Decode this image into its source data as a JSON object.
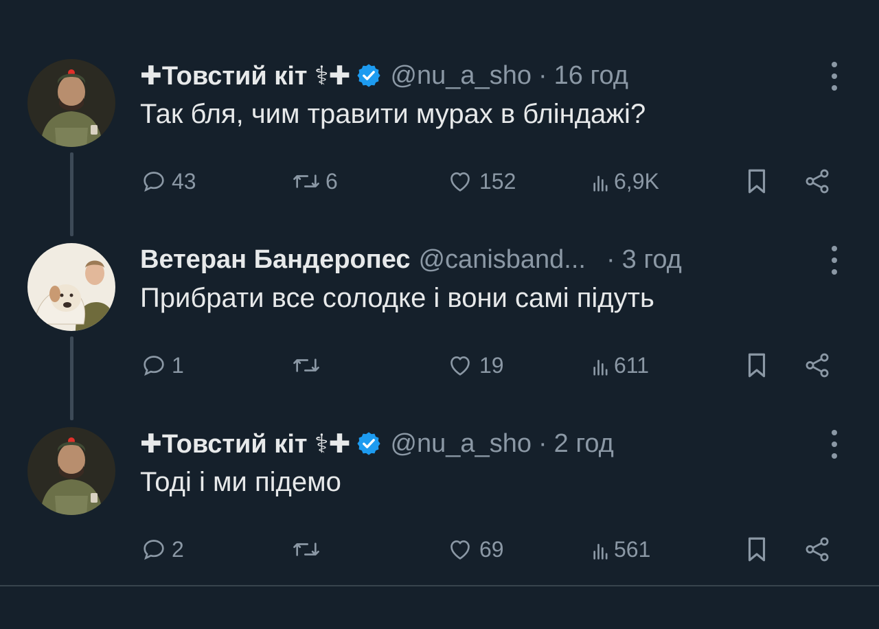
{
  "colors": {
    "background": "#15202b",
    "text_primary": "#e7e9ea",
    "text_secondary": "#8b98a5",
    "verified": "#1d9bf0",
    "divider": "#38444d"
  },
  "tweets": [
    {
      "name": "✚Товстий кіт ⚕✚",
      "verified": true,
      "handle": "@nu_a_sho",
      "separator": "·",
      "time": "16 год",
      "text": "Так бля, чим травити мурах в бліндажі?",
      "replies": "43",
      "retweets": "6",
      "likes": "152",
      "views": "6,9K",
      "avatar_icon": "soldier-avatar"
    },
    {
      "name": "Ветеран Бандеропес",
      "verified": false,
      "handle": "@canisband...",
      "separator": "·",
      "time": "3 год",
      "text": "Прибрати все солодке і вони самі підуть",
      "replies": "1",
      "retweets": "",
      "likes": "19",
      "views": "611",
      "avatar_icon": "dog-avatar"
    },
    {
      "name": "✚Товстий кіт ⚕✚",
      "verified": true,
      "handle": "@nu_a_sho",
      "separator": "·",
      "time": "2 год",
      "text": "Тоді і ми підемо",
      "replies": "2",
      "retweets": "",
      "likes": "69",
      "views": "561",
      "avatar_icon": "soldier-avatar"
    }
  ],
  "icons": [
    "reply-icon",
    "retweet-icon",
    "like-icon",
    "views-icon",
    "bookmark-icon",
    "share-icon",
    "more-icon",
    "verified-icon"
  ]
}
